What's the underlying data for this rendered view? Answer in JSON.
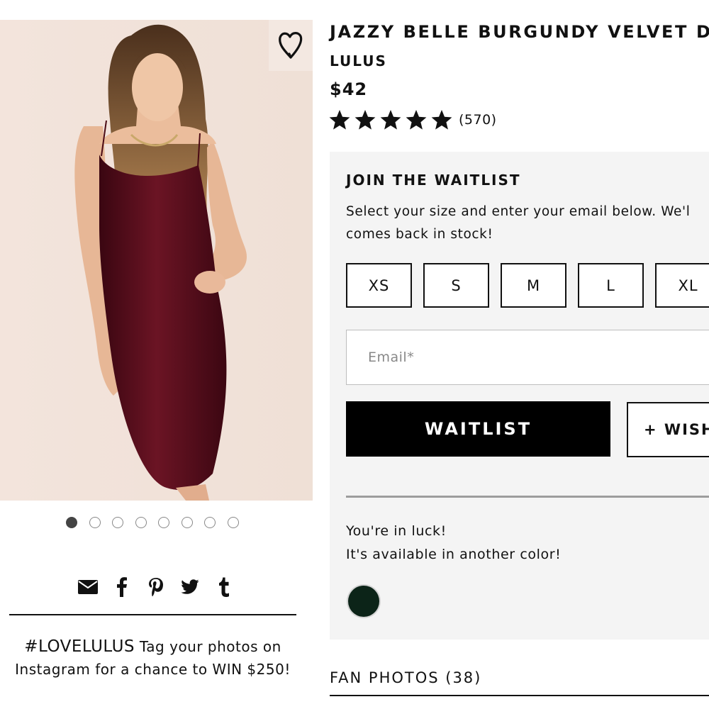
{
  "product": {
    "title": "JAZZY BELLE BURGUNDY VELVET D",
    "brand": "LULUS",
    "price": "$42",
    "rating": 5,
    "rating_count": "(570)"
  },
  "gallery": {
    "image_count": 8,
    "active_index": 0
  },
  "share": {
    "icons": [
      "email-icon",
      "facebook-icon",
      "pinterest-icon",
      "twitter-icon",
      "tumblr-icon"
    ]
  },
  "promo": {
    "hashtag": "#LOVELULUS",
    "text_1": " Tag your photos on",
    "text_2": "Instagram for a chance to WIN $250!"
  },
  "waitlist": {
    "heading": "JOIN THE WAITLIST",
    "description": "Select your size and enter your email below. We'l\ncomes back in stock!",
    "sizes": [
      "XS",
      "S",
      "M",
      "L",
      "XL"
    ],
    "email_placeholder": "Email*",
    "waitlist_label": "WAITLIST",
    "wishlist_label": "+ WISHL",
    "luck_line_1": "You're in luck!",
    "luck_line_2": "It's available in another color!"
  },
  "colors": {
    "alternate_swatch": "#0c2418",
    "dress": "#5a0f1c"
  },
  "fan_photos": {
    "label": "FAN PHOTOS (38)"
  }
}
